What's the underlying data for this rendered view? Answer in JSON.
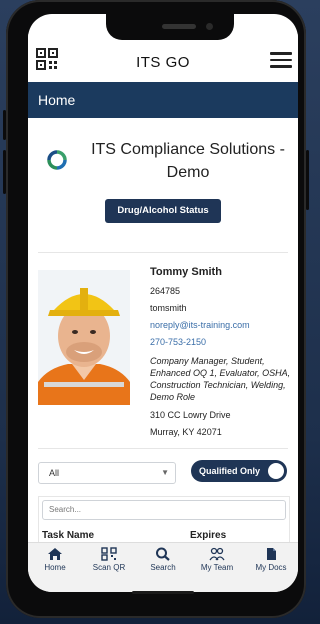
{
  "header": {
    "title": "ITS GO"
  },
  "page": {
    "title": "Home"
  },
  "company": {
    "name": "ITS Compliance Solutions - Demo",
    "button_label": "Drug/Alcohol Status"
  },
  "profile": {
    "name": "Tommy Smith",
    "id": "264785",
    "username": "tomsmith",
    "email": "noreply@its-training.com",
    "phone": "270-753-2150",
    "roles": "Company Manager, Student, Enhanced OQ 1, Evaluator, OSHA, Construction Technician, Welding, Demo Role",
    "address_line1": "310 CC Lowry Drive",
    "address_line2": "Murray, KY 42071"
  },
  "filters": {
    "select_value": "All",
    "toggle_label": "Qualified Only",
    "search_placeholder": "Search..."
  },
  "table": {
    "columns": [
      "Task Name",
      "Expires"
    ]
  },
  "nav": [
    {
      "label": "Home",
      "icon": "home-icon"
    },
    {
      "label": "Scan QR",
      "icon": "qr-code-icon"
    },
    {
      "label": "Search",
      "icon": "search-icon"
    },
    {
      "label": "My Team",
      "icon": "team-icon"
    },
    {
      "label": "My Docs",
      "icon": "document-icon"
    }
  ],
  "colors": {
    "primary": "#1f3556",
    "header_bar": "#1b3a5e",
    "link": "#3a6ea8"
  }
}
